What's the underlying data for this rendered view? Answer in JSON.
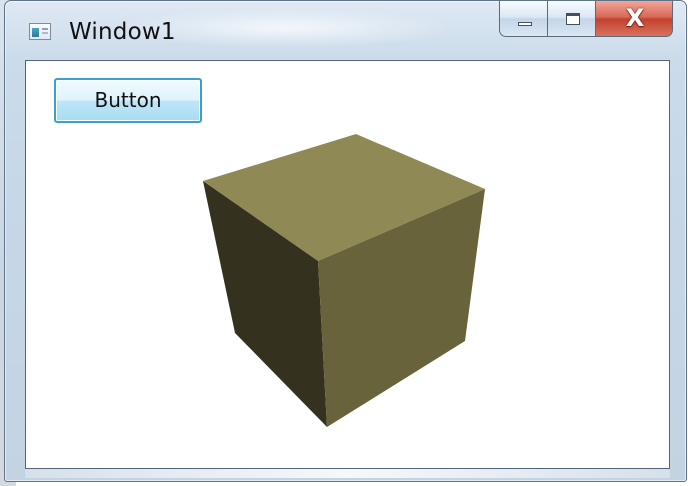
{
  "window": {
    "title": "Window1"
  },
  "caption_buttons": {
    "minimize_icon": "minimize-icon",
    "maximize_icon": "maximize-icon",
    "close_symbol": "X"
  },
  "content": {
    "button_label": "Button"
  },
  "scene": {
    "object": "cube",
    "colors": {
      "top": "#8f8a55",
      "left": "#34321f",
      "right": "#68633a"
    }
  }
}
